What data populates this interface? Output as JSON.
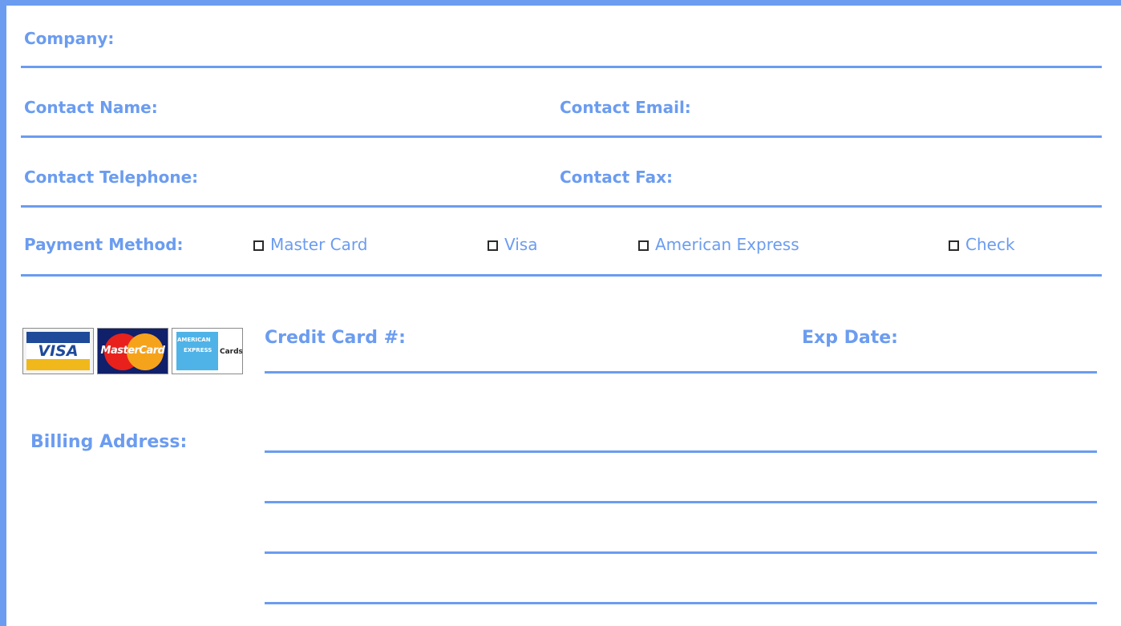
{
  "labels": {
    "company": "Company:",
    "contact_name": "Contact Name:",
    "contact_email": "Contact Email:",
    "contact_telephone": "Contact Telephone:",
    "contact_fax": "Contact Fax:",
    "payment_method": "Payment Method:",
    "credit_card_number": "Credit Card #:",
    "exp_date": "Exp Date:",
    "billing_address": "Billing Address:"
  },
  "payment_options": [
    {
      "label": "Master Card",
      "checked": false
    },
    {
      "label": "Visa",
      "checked": false
    },
    {
      "label": "American Express",
      "checked": false
    },
    {
      "label": "Check",
      "checked": false
    }
  ],
  "card_logos": {
    "visa": "VISA",
    "mastercard": "MasterCard",
    "amex_line1": "AMERICAN",
    "amex_line2": "EXPRESS",
    "amex_cards": "Cards"
  },
  "colors": {
    "accent": "#6b9cf0",
    "checkbox": "#2a2a2a"
  }
}
